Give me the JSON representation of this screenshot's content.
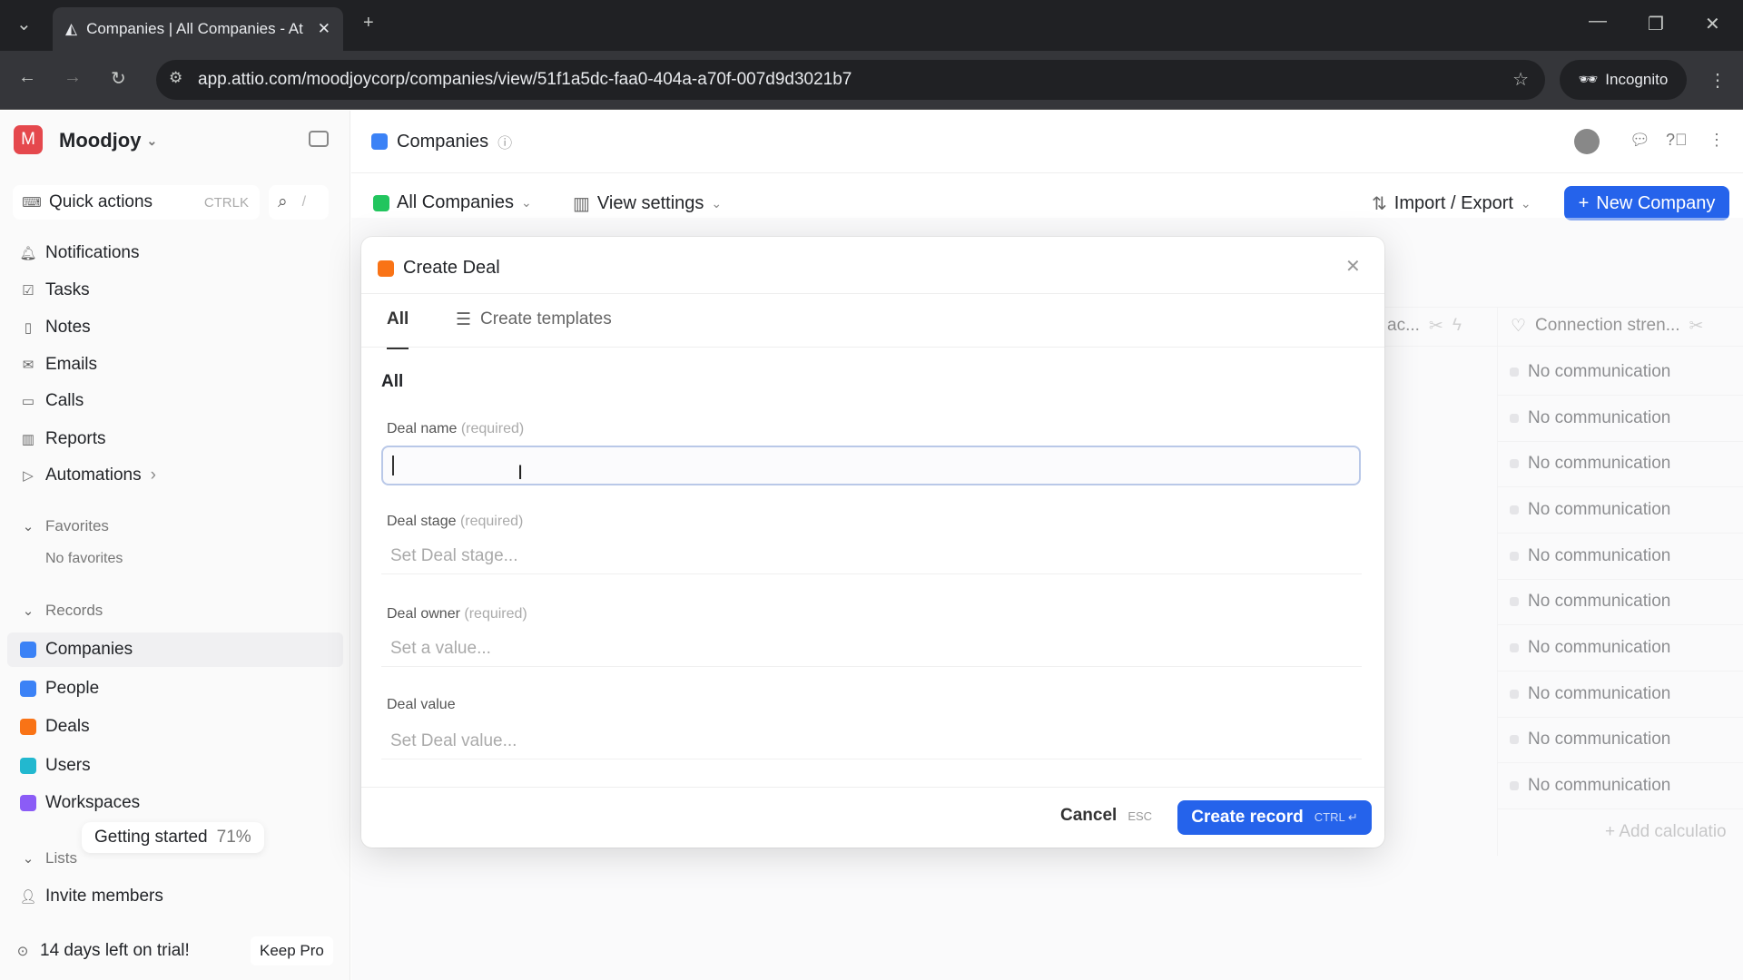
{
  "browser": {
    "tab_title": "Companies | All Companies - At",
    "url": "app.attio.com/moodjoycorp/companies/view/51f1a5dc-faa0-404a-a70f-007d9d3021b7",
    "incognito": "Incognito"
  },
  "workspace": {
    "name": "Moodjoy",
    "initial": "M"
  },
  "sidebar": {
    "quick_actions": "Quick actions",
    "quick_shortcut": "CTRLK",
    "search_shortcut": "/",
    "nav": [
      "Notifications",
      "Tasks",
      "Notes",
      "Emails",
      "Calls",
      "Reports",
      "Automations"
    ],
    "favorites_header": "Favorites",
    "no_favorites": "No favorites",
    "records_header": "Records",
    "records": [
      {
        "label": "Companies",
        "color": "#3b82f6"
      },
      {
        "label": "People",
        "color": "#3b82f6"
      },
      {
        "label": "Deals",
        "color": "#f97316"
      },
      {
        "label": "Users",
        "color": "#22b8cf"
      },
      {
        "label": "Workspaces",
        "color": "#8b5cf6"
      }
    ],
    "getting_started": "Getting started",
    "getting_started_pct": "71%",
    "lists_header": "Lists",
    "invite": "Invite members",
    "trial": "14 days left on trial!",
    "keep_pro": "Keep Pro"
  },
  "header": {
    "title": "Companies",
    "view": "All Companies",
    "view_settings": "View settings",
    "import_export": "Import / Export",
    "new_company": "New Company"
  },
  "table": {
    "partial_col": "ac...",
    "col": "Connection stren...",
    "rows": [
      "No communication",
      "No communication",
      "No communication",
      "No communication",
      "No communication",
      "No communication",
      "No communication",
      "No communication",
      "No communication",
      "No communication"
    ],
    "add_calc": "Add calculatio"
  },
  "modal": {
    "title": "Create Deal",
    "tabs": [
      "All",
      "Create templates"
    ],
    "section": "All",
    "fields": [
      {
        "label": "Deal name",
        "req": "(required)",
        "placeholder": ""
      },
      {
        "label": "Deal stage",
        "req": "(required)",
        "placeholder": "Set Deal stage..."
      },
      {
        "label": "Deal owner",
        "req": "(required)",
        "placeholder": "Set a value..."
      },
      {
        "label": "Deal value",
        "req": "",
        "placeholder": "Set Deal value..."
      }
    ],
    "cancel": "Cancel",
    "cancel_key": "ESC",
    "create": "Create record",
    "create_key": "CTRL ↵"
  },
  "colors": {
    "accent": "#2563eb",
    "brand": "#e5484d"
  }
}
